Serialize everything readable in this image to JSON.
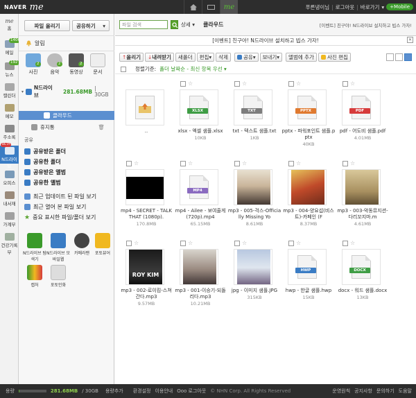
{
  "topbar": {
    "brand": "NAVER",
    "service": "me",
    "nav_me": "me",
    "user": "푸른냉이님",
    "logout": "로그아웃",
    "shortcut": "바로가기",
    "mobile": "+Mobile"
  },
  "rail": {
    "home_logo": "me",
    "home": "홈",
    "mail": "메일",
    "mail_badge": "1406",
    "news": "뉴스",
    "news_badge": "192",
    "calendar": "캘린더",
    "memo": "메모",
    "contacts": "주소록",
    "ndrive": "N드라이브",
    "ndrive_beta": "BETA",
    "office": "오피스",
    "mybook": "내서재",
    "ledger": "가계부",
    "health": "건강기록부"
  },
  "sidebar": {
    "upload": "파일 올리기",
    "share": "공유하기",
    "alarm": "알림",
    "categories": [
      {
        "label": "사진",
        "badge": "2"
      },
      {
        "label": "음악",
        "badge": "2"
      },
      {
        "label": "동영상",
        "badge": "2"
      },
      {
        "label": "문서",
        "badge": ""
      }
    ],
    "ndrive_label": "N드라이브",
    "ndrive_used": "281.68MB",
    "ndrive_total": "| 30GB",
    "cloud": "클라우드",
    "trash": "휴지통",
    "shared_section": "공유",
    "links": {
      "shared_received": "공유받은 폴더",
      "shared_folder": "공유한 폴더",
      "album_received": "공유받은 앨범",
      "album_shared": "공유한 앨범",
      "recent_updated": "최근 업데이트 된 파일 보기",
      "recent_opened": "최근 열어 본 파일 보기",
      "important": "중요 표시한 파일/폴더 보기"
    },
    "apps": [
      {
        "label": "N드라이브 탐색기"
      },
      {
        "label": "N드라이브 모바일웹"
      },
      {
        "label": "카메라맨"
      },
      {
        "label": "포토뷰어"
      },
      {
        "label": "캡처"
      },
      {
        "label": "포토인화"
      }
    ]
  },
  "main": {
    "search_placeholder": "파일 검색",
    "detail": "상세",
    "cloud_title": "클라우드",
    "event_top": "[이벤트] 친구야! N드라이브 설치하고 빕스 가자!",
    "event_promo": "[이벤트] 친구야! N드라이브 설치하고 빕스 가자!",
    "toolbar": {
      "upload": "올리기",
      "download": "내려받기",
      "new_folder": "새폴더",
      "edit": "편집",
      "delete": "삭제",
      "share": "공유",
      "send": "보내기",
      "add_album": "앨범에 추가",
      "photo_print": "사진 편집"
    },
    "sort_prefix": "정렬기준:",
    "sort_value": "폴더 날짜순 - 최신 항목 우선 ▾",
    "files": [
      {
        "name": "..",
        "size": "",
        "kind": "up"
      },
      {
        "name": "xlsx - 엑셀 샘플.xlsx",
        "size": "10KB",
        "kind": "XLSX",
        "color": "#3f9d45"
      },
      {
        "name": "txt - 텍스트 샘플.txt",
        "size": "1KB",
        "kind": "TXT",
        "color": "#7d7d7d"
      },
      {
        "name": "pptx - 파워포인트 샘플.pptx",
        "size": "40KB",
        "kind": "PPTX",
        "color": "#e07a30"
      },
      {
        "name": "pdf - 어도비 샘플.pdf",
        "size": "4.01MB",
        "kind": "PDF",
        "color": "#d63b3b"
      },
      {
        "name": "mp4 - SECRET - TALK THAT (1080p).",
        "size": "170.8MB",
        "kind": "black"
      },
      {
        "name": "mp4 - Ailee - 보여줄게 (720p).mp4",
        "size": "65.15MB",
        "kind": "MP4",
        "color": "#8a6bc0"
      },
      {
        "name": "mp3 - 005-걱스-Officially Missing Yo",
        "size": "8.61MB",
        "kind": "photo1"
      },
      {
        "name": "mp3 - 004-양요섭(비스트)-카페인 (F",
        "size": "8.37MB",
        "kind": "photo2"
      },
      {
        "name": "mp3 - 003-악동뮤지션-다리꼬지마.m",
        "size": "4.61MB",
        "kind": "photo3"
      },
      {
        "name": "mp3 - 002-로이킴-스쳐간다.mp3",
        "size": "9.57MB",
        "kind": "roykim",
        "overlay": "ROY KIM"
      },
      {
        "name": "mp3 - 001-이승기-되돌리다.mp3",
        "size": "10.21MB",
        "kind": "photo4"
      },
      {
        "name": "jpg - 이미지 샘플.JPG",
        "size": "315KB",
        "kind": "photo5"
      },
      {
        "name": "hwp - 한글 샘플.hwp",
        "size": "15KB",
        "kind": "HWP",
        "color": "#3a7cc4"
      },
      {
        "name": "docx - 워드 샘플.docx",
        "size": "13KB",
        "kind": "DOCX",
        "color": "#3f9d45"
      }
    ]
  },
  "footer": {
    "usage_label": "용량",
    "usage_used": "281.68MB",
    "usage_total": "/ 30GB",
    "add_storage": "용량추가",
    "settings": "환경설정",
    "guide": "이용안내",
    "login": "Ooo 로그아웃",
    "copyright": "© NHN Corp. All Rights Reserved",
    "policy": "운영원칙",
    "notice": "공지사항",
    "inquiry": "문의하기",
    "help": "도움말"
  },
  "colors": {
    "green": "#58a22c",
    "blue_select": "#5b8fd0",
    "topbar": "#2d2d2d"
  }
}
